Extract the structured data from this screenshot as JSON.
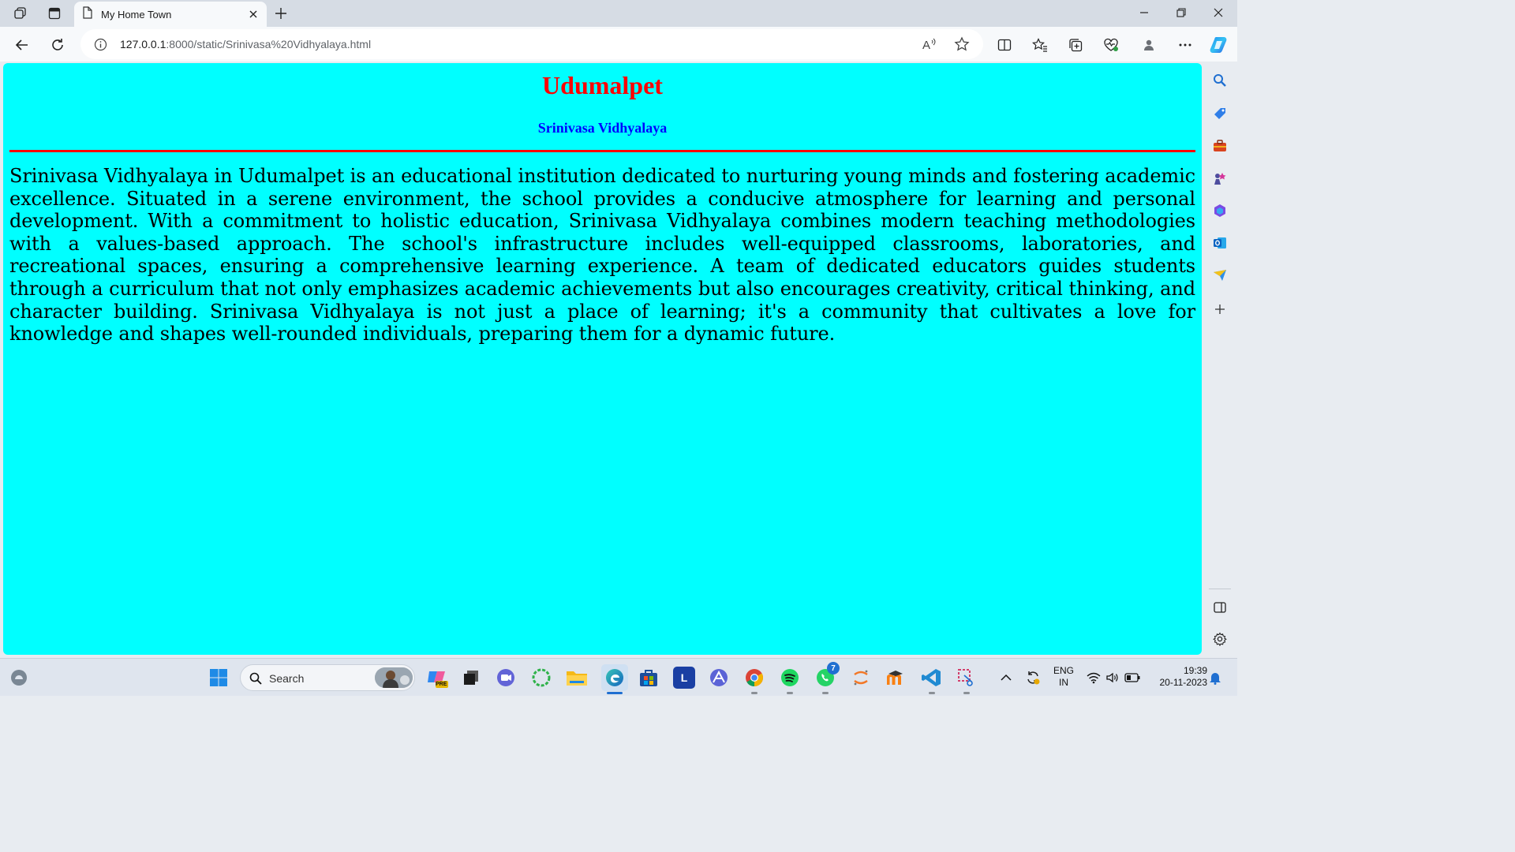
{
  "browser": {
    "tab": {
      "title": "My Home Town"
    },
    "address": {
      "host": "127.0.0.1",
      "rest": ":8000/static/Srinivasa%20Vidhyalaya.html"
    }
  },
  "page": {
    "heading": "Udumalpet",
    "subheading": "Srinivasa Vidhyalaya",
    "paragraph": "Srinivasa Vidhyalaya in Udumalpet is an educational institution dedicated to nurturing young minds and fostering academic excellence. Situated in a serene environment, the school provides a conducive atmosphere for learning and personal development. With a commitment to holistic education, Srinivasa Vidhyalaya combines modern teaching methodologies with a values-based approach. The school's infrastructure includes well-equipped classrooms, laboratories, and recreational spaces, ensuring a comprehensive learning experience. A team of dedicated educators guides students through a curriculum that not only emphasizes academic achievements but also encourages creativity, critical thinking, and character building. Srinivasa Vidhyalaya is not just a place of learning; it's a community that cultivates a love for knowledge and shapes well-rounded individuals, preparing them for a dynamic future."
  },
  "colors": {
    "page_background": "#00ffff",
    "heading": "#ff0000",
    "subheading": "#0000ff",
    "rule": "#ff0000"
  },
  "taskbar": {
    "search_label": "Search",
    "whatsapp_badge": "7",
    "copilot_badge": "PRE",
    "l_app_letter": "L",
    "lang_line1": "ENG",
    "lang_line2": "IN",
    "time": "19:39",
    "date": "20-11-2023"
  }
}
